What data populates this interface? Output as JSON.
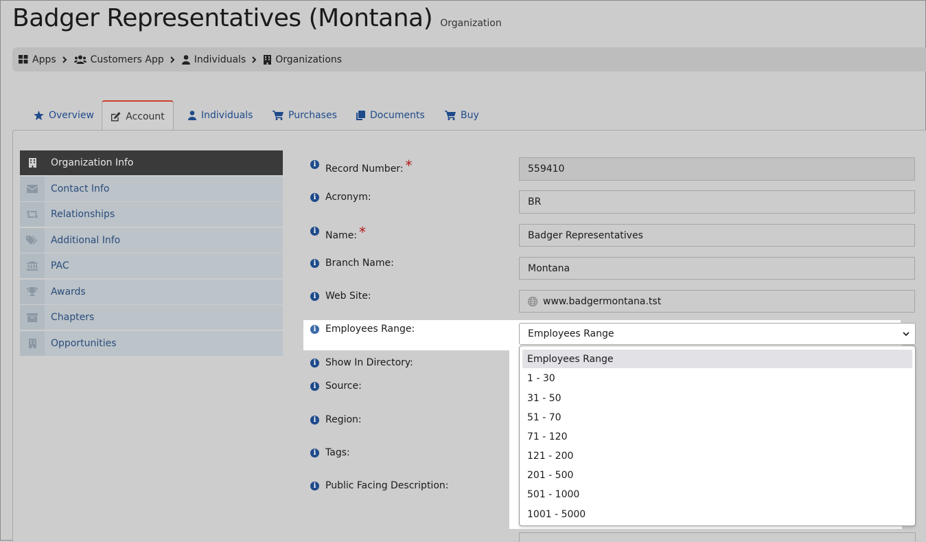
{
  "header": {
    "title": "Badger Representatives (Montana)",
    "subtitle": "Organization"
  },
  "breadcrumb": [
    {
      "label": "Apps",
      "icon": "grid-icon"
    },
    {
      "label": "Customers App",
      "icon": "users-icon"
    },
    {
      "label": "Individuals",
      "icon": "user-icon"
    },
    {
      "label": "Organizations",
      "icon": "building-icon"
    }
  ],
  "tabs": [
    {
      "label": "Overview",
      "icon": "star-icon"
    },
    {
      "label": "Account",
      "icon": "edit-icon",
      "active": true
    },
    {
      "label": "Individuals",
      "icon": "user-icon"
    },
    {
      "label": "Purchases",
      "icon": "cart-icon"
    },
    {
      "label": "Documents",
      "icon": "copy-icon"
    },
    {
      "label": "Buy",
      "icon": "cart-icon"
    }
  ],
  "sidenav": [
    {
      "label": "Organization Info",
      "icon": "building-icon",
      "active": true
    },
    {
      "label": "Contact Info",
      "icon": "envelope-icon"
    },
    {
      "label": "Relationships",
      "icon": "retweet-icon"
    },
    {
      "label": "Additional Info",
      "icon": "tags-icon"
    },
    {
      "label": "PAC",
      "icon": "bank-icon"
    },
    {
      "label": "Awards",
      "icon": "trophy-icon"
    },
    {
      "label": "Chapters",
      "icon": "archive-icon"
    },
    {
      "label": "Opportunities",
      "icon": "building-icon"
    }
  ],
  "form": {
    "record_number": {
      "label": "Record Number:",
      "value": "559410"
    },
    "acronym": {
      "label": "Acronym:",
      "value": "BR"
    },
    "name": {
      "label": "Name:",
      "value": "Badger Representatives"
    },
    "branch_name": {
      "label": "Branch Name:",
      "value": "Montana"
    },
    "web_site": {
      "label": "Web Site:",
      "value": "www.badgermontana.tst"
    },
    "employees_range": {
      "label": "Employees Range:",
      "value": "Employees Range"
    },
    "show_in_directory": {
      "label": "Show In Directory:"
    },
    "source": {
      "label": "Source:"
    },
    "region": {
      "label": "Region:"
    },
    "tags": {
      "label": "Tags:"
    },
    "public_facing_description": {
      "label": "Public Facing Description:"
    },
    "required_mark": "*",
    "info_glyph": "i"
  },
  "employees_options": [
    "Employees Range",
    "1 - 30",
    "31 - 50",
    "51 - 70",
    "71 - 120",
    "121 - 200",
    "201 - 500",
    "501 - 1000",
    "1001 - 5000"
  ],
  "colors": {
    "link": "#1e4a8a",
    "active_tab_border": "#c9402c",
    "nav_active": "#3a3a3a",
    "required": "#b21a1a"
  }
}
